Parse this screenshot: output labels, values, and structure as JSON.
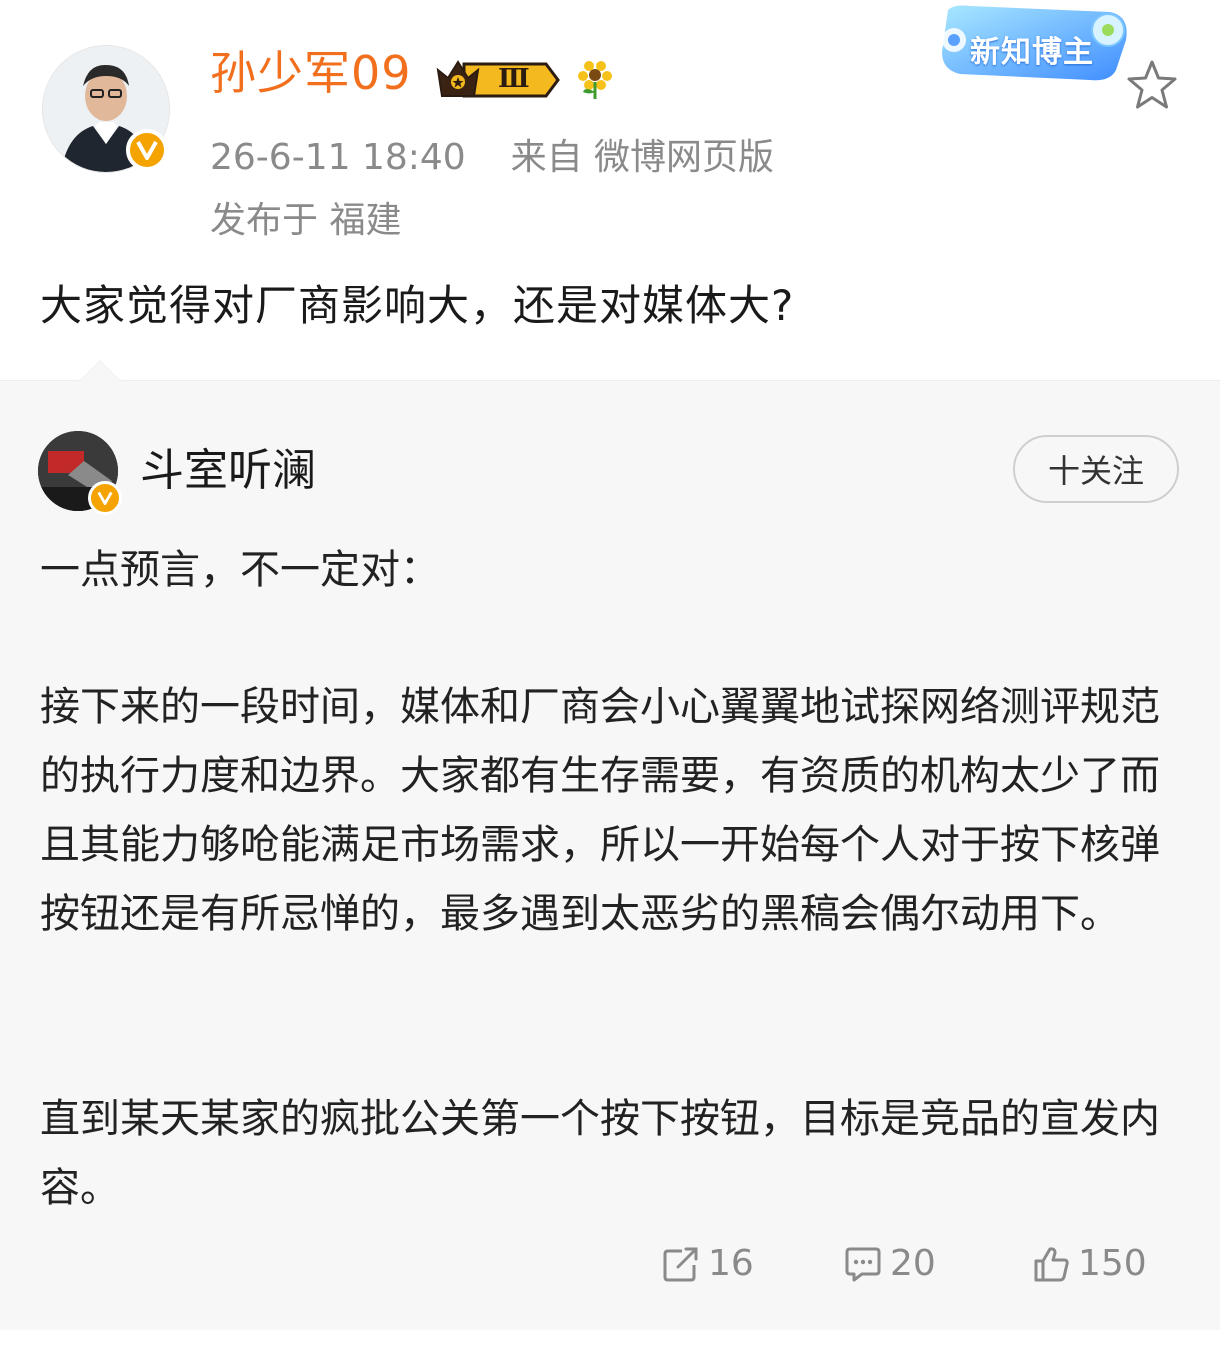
{
  "post": {
    "author": "孙少军09",
    "level_badge": "Ⅲ",
    "timestamp": "26-6-11 18:40",
    "source": "来自 微博网页版",
    "location": "发布于 福建",
    "content": "大家觉得对厂商影响大，还是对媒体大?",
    "badge_text": "新知博主"
  },
  "quoted": {
    "author": "斗室听澜",
    "follow_label": "十关注",
    "paragraphs": [
      "一点预言，不一定对：",
      "接下来的一段时间，媒体和厂商会小心翼翼地试探网络测评规范的执行力度和边界。大家都有生存需要，有资质的机构太少了而且其能力够呛能满足市场需求，所以一开始每个人对于按下核弹按钮还是有所忌惮的，最多遇到太恶劣的黑稿会偶尔动用下。",
      "直到某天某家的疯批公关第一个按下按钮，目标是竞品的宣发内容。"
    ],
    "stats": {
      "reposts": "16",
      "comments": "20",
      "likes": "150"
    }
  },
  "icons": {
    "star": "star-icon",
    "repost": "repost-icon",
    "comment": "comment-icon",
    "like": "like-icon",
    "crown": "crown-icon",
    "flower": "sunflower-icon"
  },
  "colors": {
    "author_name": "#f26f1e",
    "verify": "#f5a300",
    "meta": "#8a8a8a",
    "quote_bg": "#f7f7f7"
  }
}
